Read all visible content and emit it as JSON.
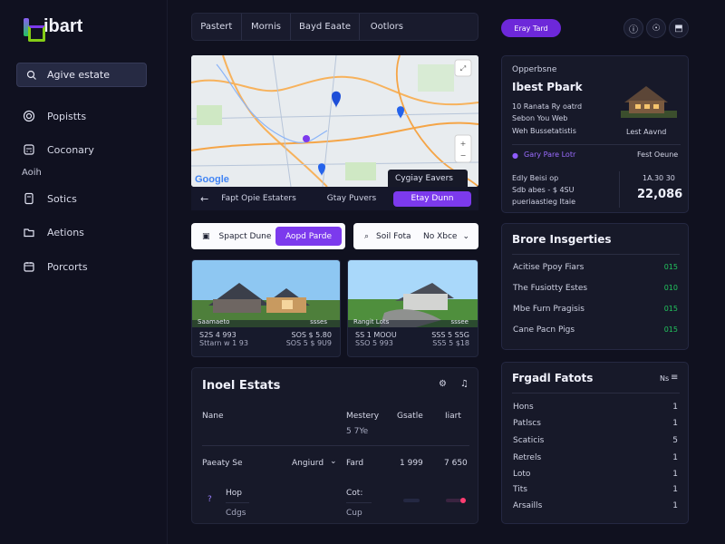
{
  "brand": {
    "name": "ibart"
  },
  "sidebar": {
    "search_label": "Agive estate",
    "items": [
      {
        "label": "Popistts",
        "icon": "target-icon"
      },
      {
        "label": "Coconary",
        "icon": "calculator-icon"
      },
      {
        "label": "Sotics",
        "icon": "document-icon"
      },
      {
        "label": "Aetions",
        "icon": "folder-icon"
      },
      {
        "label": "Porcorts",
        "icon": "calendar-icon"
      }
    ],
    "section_label": "Aoih"
  },
  "top_tabs": [
    "Pastert",
    "Mornis",
    "Bayd Eaate",
    "Ootlors"
  ],
  "map": {
    "provider_label": "Google",
    "overlay_label": "Cygiay Eavers",
    "bar_left_label": "Fapt Opie Estaters",
    "bar_mid_label": "Gtay Puvers",
    "bar_button": "Etay Dunn"
  },
  "filters": {
    "left_label": "Spapct Dune",
    "left_button": "Aopd Parde",
    "right_label": "Soil Fota",
    "right_value": "No Xbce"
  },
  "cards": [
    {
      "caption": "Saamaeto",
      "caption_right": "ssses",
      "left1": "S2S 4 993",
      "right1": "SOS $ 5.80",
      "left2": "Sttarn w 1 93",
      "right2": "SOS 5 $ 9U9"
    },
    {
      "caption": "Rangit Lots",
      "caption_right": "sssee",
      "left1": "SS 1 MOOU",
      "right1": "SSS 5 S5G",
      "left2": "SSO 5 993",
      "right2": "SS5 5 $18"
    }
  ],
  "table": {
    "title": "Inoel Estats",
    "headers": [
      "Nane",
      "Mestery",
      "Gsatle",
      "Iiart"
    ],
    "subheader": "5 7Ye",
    "row1": {
      "name": "Paeaty Se",
      "mestery": "Angiurd",
      "gsatle": "Fard",
      "a": "1 999",
      "b": "7 650"
    },
    "row2": {
      "name1": "Hop",
      "name2": "Cdgs",
      "mestery1": "Cot:",
      "mestery2": "Cup"
    }
  },
  "top_right": {
    "button": "Eray Tard",
    "circle_icons": [
      "info-icon",
      "link-icon",
      "image-icon"
    ]
  },
  "property_panel": {
    "kicker": "Opperbsne",
    "title": "Ibest Pbark",
    "lines": [
      "10 Ranata Ry oatrd",
      "Sebon You Web",
      "Weh Bussetatistis"
    ],
    "badge": "Gary Pare Lotr",
    "badge_right": "Fest Oeune",
    "left_lines": [
      "Edly Beisi op",
      "Sdb abes - $ 4SU",
      "pueriaastieg Itaie"
    ],
    "stat_small": "1A.30 30",
    "stat_big": "22,086",
    "house_label": "Lest Aavnd"
  },
  "properties_panel": {
    "title": "Brore Insgerties",
    "rows": [
      {
        "label": "Acitise Ppoy Fiars",
        "value": "015"
      },
      {
        "label": "The Fusiotty Estes",
        "value": "010"
      },
      {
        "label": "Mbe Furn Pragisis",
        "value": "015"
      },
      {
        "label": "Cane Pacn Pigs",
        "value": "015"
      }
    ]
  },
  "facts_panel": {
    "title": "Frgadl Fatots",
    "right_label": "Ns",
    "rows": [
      {
        "label": "Hons",
        "value": "1"
      },
      {
        "label": "Patlscs",
        "value": "1"
      },
      {
        "label": "Scaticis",
        "value": "5"
      },
      {
        "label": "Retrels",
        "value": "1"
      },
      {
        "label": "Loto",
        "value": "1"
      },
      {
        "label": "Tits",
        "value": "1"
      },
      {
        "label": "Arsaills",
        "value": "1"
      }
    ]
  },
  "colors": {
    "accent": "#7c3aed",
    "green": "#22c55e",
    "bg": "#10111f"
  }
}
